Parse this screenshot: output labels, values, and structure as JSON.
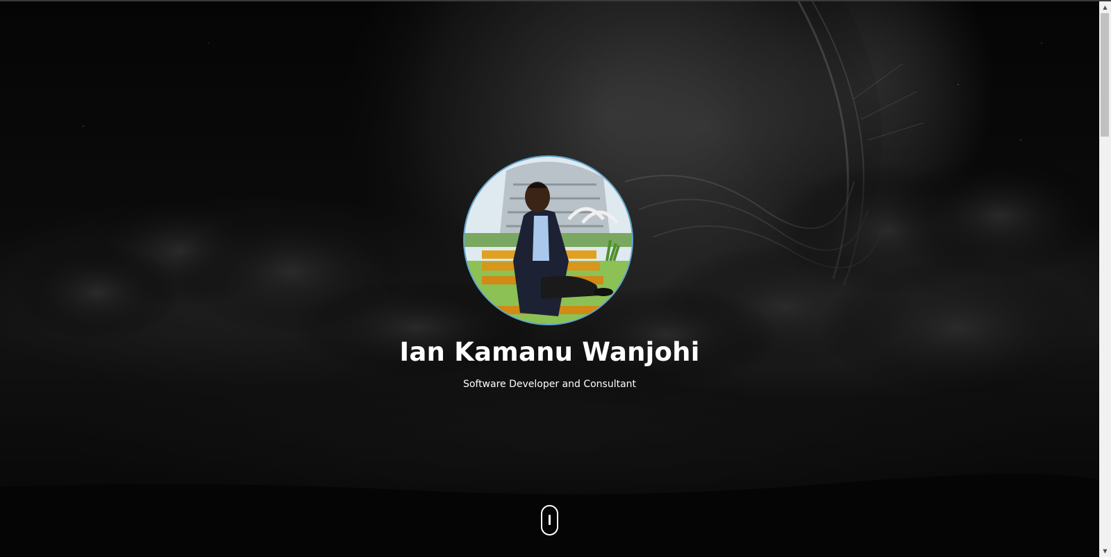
{
  "hero": {
    "name": "Ian Kamanu Wanjohi",
    "subtitle": "Software Developer and Consultant",
    "portrait_icon": "profile-photo",
    "scroll_indicator_icon": "mouse-scroll-icon"
  },
  "colors": {
    "background": "#000000",
    "text": "#ffffff",
    "portrait_border": "#5fa7cf",
    "scrollbar_track": "#f1f1f1",
    "scrollbar_thumb": "#c1c1c1"
  },
  "scrollbar": {
    "up_arrow": "▲",
    "down_arrow": "▼"
  }
}
